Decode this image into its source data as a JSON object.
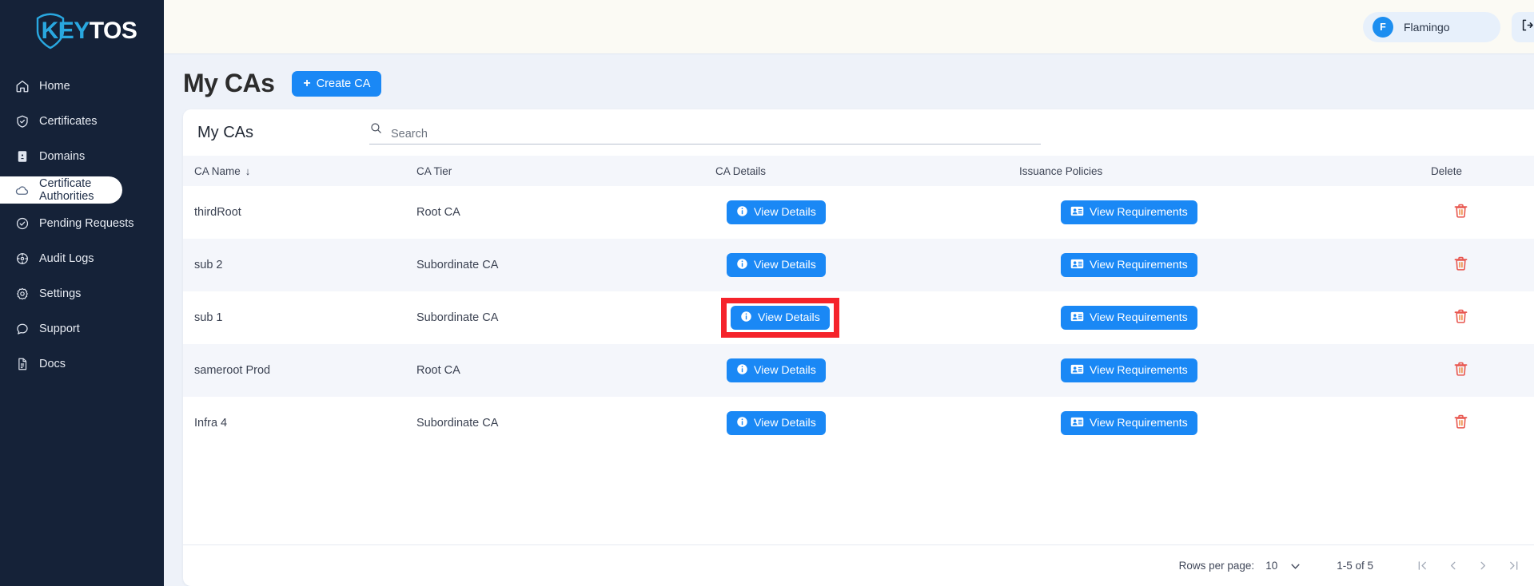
{
  "brand": {
    "name_primary": "KEY",
    "name_secondary": "TOS",
    "accent": "#29a8e0"
  },
  "sidebar": {
    "items": [
      {
        "label": "Home",
        "icon": "home-icon",
        "active": false
      },
      {
        "label": "Certificates",
        "icon": "shield-check-icon",
        "active": false
      },
      {
        "label": "Domains",
        "icon": "contact-book-icon",
        "active": false
      },
      {
        "label": "Certificate Authorities",
        "icon": "cloud-icon",
        "active": true
      },
      {
        "label": "Pending Requests",
        "icon": "check-circle-icon",
        "active": false
      },
      {
        "label": "Audit Logs",
        "icon": "target-icon",
        "active": false
      },
      {
        "label": "Settings",
        "icon": "gear-icon",
        "active": false
      },
      {
        "label": "Support",
        "icon": "chat-bubble-icon",
        "active": false
      },
      {
        "label": "Docs",
        "icon": "document-icon",
        "active": false
      }
    ]
  },
  "topbar": {
    "user_initial": "F",
    "user_name": "Flamingo",
    "logout_icon": "logout-icon"
  },
  "page": {
    "title": "My CAs",
    "create_button": "Create CA",
    "create_button_plus": "+"
  },
  "card": {
    "title": "My CAs",
    "search": {
      "value": "",
      "placeholder": "Search",
      "icon": "search-icon"
    },
    "columns": [
      "CA Name",
      "CA Tier",
      "CA Details",
      "Issuance Policies",
      "Delete"
    ],
    "sort_column": "CA Name",
    "sort_direction": "↓",
    "details_button_label": "View Details",
    "policies_button_label": "View Requirements",
    "delete_icon": "trash-icon",
    "rows": [
      {
        "name": "thirdRoot",
        "tier": "Root CA"
      },
      {
        "name": "sub 2",
        "tier": "Subordinate CA"
      },
      {
        "name": "sub 1",
        "tier": "Subordinate CA",
        "highlighted": true
      },
      {
        "name": "sameroot Prod",
        "tier": "Root CA"
      },
      {
        "name": "Infra 4",
        "tier": "Subordinate CA"
      }
    ]
  },
  "footer": {
    "rows_per_page_label": "Rows per page:",
    "rows_per_page_value": "10",
    "range": "1-5 of 5",
    "first_icon": "first-page-icon",
    "prev_icon": "previous-page-icon",
    "next_icon": "next-page-icon",
    "last_icon": "last-page-icon"
  },
  "colors": {
    "accent_blue": "#1a88f5",
    "sidebar_bg": "#152238",
    "delete_red": "#e8564f",
    "highlight_red": "#f5232b"
  }
}
